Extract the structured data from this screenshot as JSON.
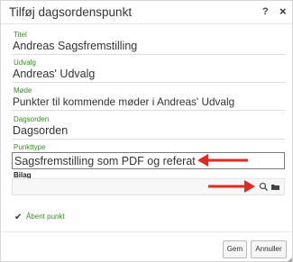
{
  "dialog": {
    "title": "Tilføj dagsordenspunkt",
    "help_label": "?",
    "close_label": "×"
  },
  "fields": {
    "titel": {
      "label": "Titel",
      "value": "Andreas Sagsfremstilling"
    },
    "udvalg": {
      "label": "Udvalg",
      "value": "Andreas' Udvalg"
    },
    "mode": {
      "label": "Møde",
      "value": "Punkter til kommende møder i Andreas' Udvalg"
    },
    "dagsorden": {
      "label": "Dagsorden",
      "value": "Dagsorden"
    },
    "punkttype": {
      "label": "Punkttype",
      "value": "Sagsfremstilling som PDF og referat"
    },
    "bilag": {
      "label": "Bilag",
      "value": ""
    }
  },
  "checkbox": {
    "label": "Åbent punkt",
    "checked": true
  },
  "buttons": {
    "save": "Gem",
    "cancel": "Annuller"
  },
  "icons": {
    "search": "search-icon",
    "folder": "folder-icon"
  },
  "colors": {
    "label_green": "#3d8b2f",
    "annotation_red": "#e02a23"
  }
}
